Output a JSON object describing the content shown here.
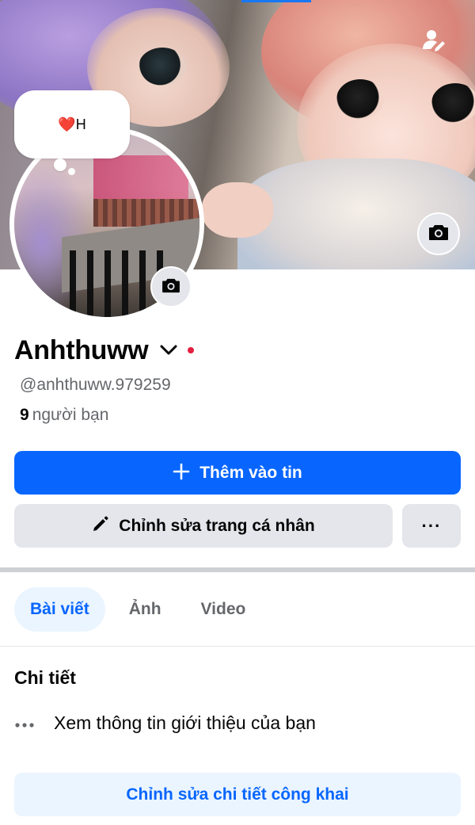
{
  "profile": {
    "name": "Anhthuww",
    "username": "@anhthuww.979259",
    "friends_count": "9",
    "friends_label": "người bạn",
    "note": "❤️H"
  },
  "actions": {
    "add_story_label": "Thêm vào tin",
    "edit_profile_label": "Chỉnh sửa trang cá nhân",
    "more_label": "···"
  },
  "tabs": [
    {
      "label": "Bài viết",
      "active": true
    },
    {
      "label": "Ảnh",
      "active": false
    },
    {
      "label": "Video",
      "active": false
    }
  ],
  "details": {
    "title": "Chi tiết",
    "about_placeholder": "Xem thông tin giới thiệu của bạn",
    "edit_public_details_label": "Chỉnh sửa chi tiết công khai"
  },
  "icons": {
    "cover_camera": "camera-icon",
    "avatar_camera": "camera-icon",
    "cover_profile": "person-edit-icon",
    "chevron": "chevron-down-icon",
    "edit": "pencil-icon",
    "add": "plus-icon"
  },
  "colors": {
    "primary": "#0866ff",
    "secondary_bg": "#ebf5ff",
    "button_gray": "#e4e6eb",
    "text_muted": "#65676b",
    "status_dot": "#e41e3f"
  }
}
